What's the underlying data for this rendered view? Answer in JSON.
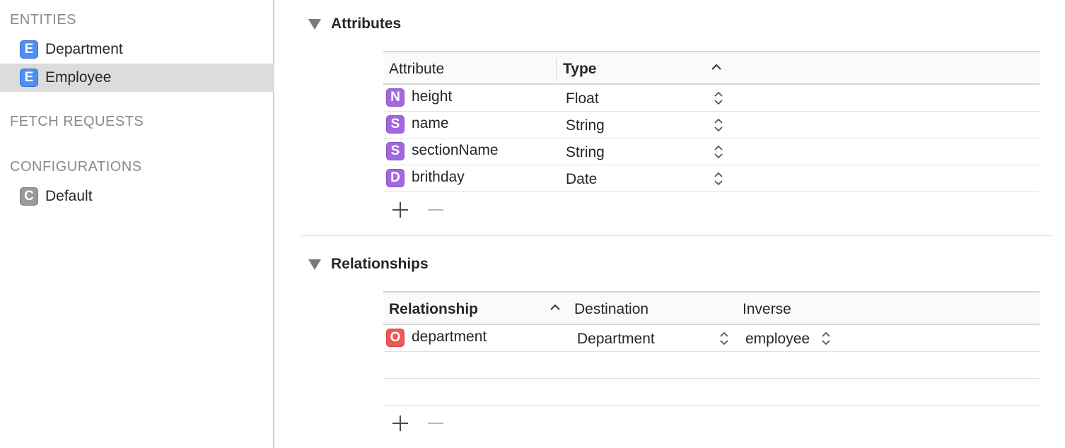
{
  "sidebar": {
    "entities_header": "ENTITIES",
    "entities": [
      {
        "badge": "E",
        "label": "Department",
        "selected": false
      },
      {
        "badge": "E",
        "label": "Employee",
        "selected": true
      }
    ],
    "fetch_requests_header": "FETCH REQUESTS",
    "configurations_header": "CONFIGURATIONS",
    "configurations": [
      {
        "badge": "C",
        "label": "Default"
      }
    ]
  },
  "attributes": {
    "title": "Attributes",
    "columns": {
      "attribute": "Attribute",
      "type": "Type"
    },
    "rows": [
      {
        "badge": "N",
        "name": "height",
        "type": "Float"
      },
      {
        "badge": "S",
        "name": "name",
        "type": "String"
      },
      {
        "badge": "S",
        "name": "sectionName",
        "type": "String"
      },
      {
        "badge": "D",
        "name": "brithday",
        "type": "Date"
      }
    ]
  },
  "relationships": {
    "title": "Relationships",
    "columns": {
      "relationship": "Relationship",
      "destination": "Destination",
      "inverse": "Inverse"
    },
    "rows": [
      {
        "badge": "O",
        "name": "department",
        "destination": "Department",
        "inverse": "employee"
      }
    ]
  },
  "icons": {
    "disclosure": "disclosure-triangle-down-icon",
    "sort": "chevron-up-icon",
    "stepper": "up-down-stepper-icon",
    "add": "plus-icon",
    "remove": "minus-icon"
  },
  "colors": {
    "entity_badge": "#4f8ef2",
    "attribute_badge": "#a367e0",
    "relationship_badge": "#ec5a55",
    "config_badge": "#9a9a9a",
    "selection": "#dcdcdc"
  }
}
